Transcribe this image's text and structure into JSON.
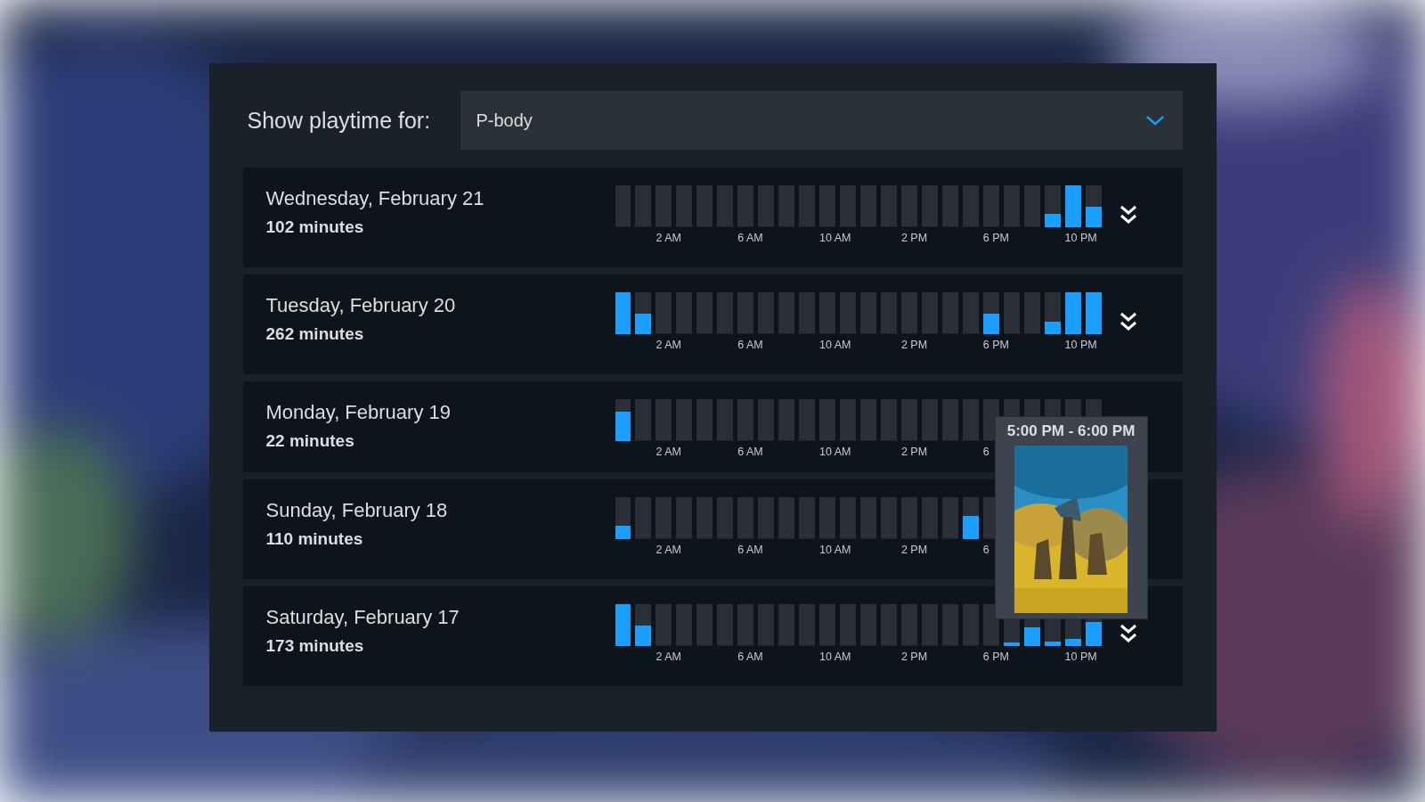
{
  "header": {
    "label": "Show playtime for:",
    "dropdown": {
      "value": "P-body"
    }
  },
  "days": [
    {
      "date": "Wednesday, February 21",
      "total": "102 minutes",
      "hours": [
        {
          "level": 0
        },
        {
          "level": 0
        },
        {
          "level": 0
        },
        {
          "level": 0
        },
        {
          "level": 0
        },
        {
          "level": 0
        },
        {
          "level": 0
        },
        {
          "level": 0
        },
        {
          "level": 0
        },
        {
          "level": 0
        },
        {
          "level": 0
        },
        {
          "level": 0
        },
        {
          "level": 0
        },
        {
          "level": 0
        },
        {
          "level": 0
        },
        {
          "level": 0
        },
        {
          "level": 0
        },
        {
          "level": 0
        },
        {
          "level": 0
        },
        {
          "level": 0
        },
        {
          "level": 0
        },
        {
          "level": 0.33
        },
        {
          "level": 1
        },
        {
          "level": 0.5
        }
      ],
      "ticks": [
        "2 AM",
        "6 AM",
        "10 AM",
        "2 PM",
        "6 PM",
        "10 PM"
      ],
      "expand_button": {
        "kind": "double-chevron"
      }
    },
    {
      "date": "Tuesday, February 20",
      "total": "262 minutes",
      "hours": [
        {
          "level": 1
        },
        {
          "level": 0.5
        },
        {
          "level": 0
        },
        {
          "level": 0
        },
        {
          "level": 0
        },
        {
          "level": 0
        },
        {
          "level": 0
        },
        {
          "level": 0
        },
        {
          "level": 0
        },
        {
          "level": 0
        },
        {
          "level": 0
        },
        {
          "level": 0
        },
        {
          "level": 0
        },
        {
          "level": 0
        },
        {
          "level": 0
        },
        {
          "level": 0
        },
        {
          "level": 0
        },
        {
          "level": 0
        },
        {
          "level": 0.5
        },
        {
          "level": 0
        },
        {
          "level": 0
        },
        {
          "level": 0.3
        },
        {
          "level": 1
        },
        {
          "level": 1
        }
      ],
      "ticks": [
        "2 AM",
        "6 AM",
        "10 AM",
        "2 PM",
        "6 PM",
        "10 PM"
      ],
      "expand_button": {
        "kind": "double-chevron"
      }
    },
    {
      "date": "Monday, February 19",
      "total": "22 minutes",
      "hours": [
        {
          "level": 0.7
        },
        {
          "level": 0
        },
        {
          "level": 0
        },
        {
          "level": 0
        },
        {
          "level": 0
        },
        {
          "level": 0
        },
        {
          "level": 0
        },
        {
          "level": 0
        },
        {
          "level": 0
        },
        {
          "level": 0
        },
        {
          "level": 0
        },
        {
          "level": 0
        },
        {
          "level": 0
        },
        {
          "level": 0
        },
        {
          "level": 0
        },
        {
          "level": 0
        },
        {
          "level": 0
        },
        {
          "level": 0
        },
        {
          "level": 0
        },
        {
          "level": 0
        },
        {
          "level": 0
        },
        {
          "level": 0
        },
        {
          "level": 0
        },
        {
          "level": 0
        }
      ],
      "ticks": [
        "2 AM",
        "6 AM",
        "10 AM",
        "2 PM",
        "6"
      ]
    },
    {
      "date": "Sunday, February 18",
      "total": "110 minutes",
      "hours": [
        {
          "level": 0.33
        },
        {
          "level": 0
        },
        {
          "level": 0
        },
        {
          "level": 0
        },
        {
          "level": 0
        },
        {
          "level": 0
        },
        {
          "level": 0
        },
        {
          "level": 0
        },
        {
          "level": 0
        },
        {
          "level": 0
        },
        {
          "level": 0
        },
        {
          "level": 0
        },
        {
          "level": 0
        },
        {
          "level": 0
        },
        {
          "level": 0
        },
        {
          "level": 0
        },
        {
          "level": 0
        },
        {
          "level": 0.55
        },
        {
          "level": 0
        }
      ],
      "ticks": [
        "2 AM",
        "6 AM",
        "10 AM",
        "2 PM",
        "6"
      ]
    },
    {
      "date": "Saturday, February 17",
      "total": "173 minutes",
      "hours": [
        {
          "level": 1
        },
        {
          "level": 0.5
        },
        {
          "level": 0
        },
        {
          "level": 0
        },
        {
          "level": 0
        },
        {
          "level": 0
        },
        {
          "level": 0
        },
        {
          "level": 0
        },
        {
          "level": 0
        },
        {
          "level": 0
        },
        {
          "level": 0
        },
        {
          "level": 0
        },
        {
          "level": 0
        },
        {
          "level": 0
        },
        {
          "level": 0
        },
        {
          "level": 0
        },
        {
          "level": 0
        },
        {
          "level": 0
        },
        {
          "level": 0
        },
        {
          "level": 0.08
        },
        {
          "level": 0.45
        },
        {
          "level": 0.1
        },
        {
          "level": 0.18
        },
        {
          "level": 0.58
        }
      ],
      "ticks": [
        "2 AM",
        "6 AM",
        "10 AM",
        "2 PM",
        "6 PM",
        "10 PM"
      ],
      "expand_button": {
        "kind": "double-chevron"
      }
    }
  ],
  "tooltip": {
    "time_range": "5:00 PM - 6:00 PM"
  }
}
